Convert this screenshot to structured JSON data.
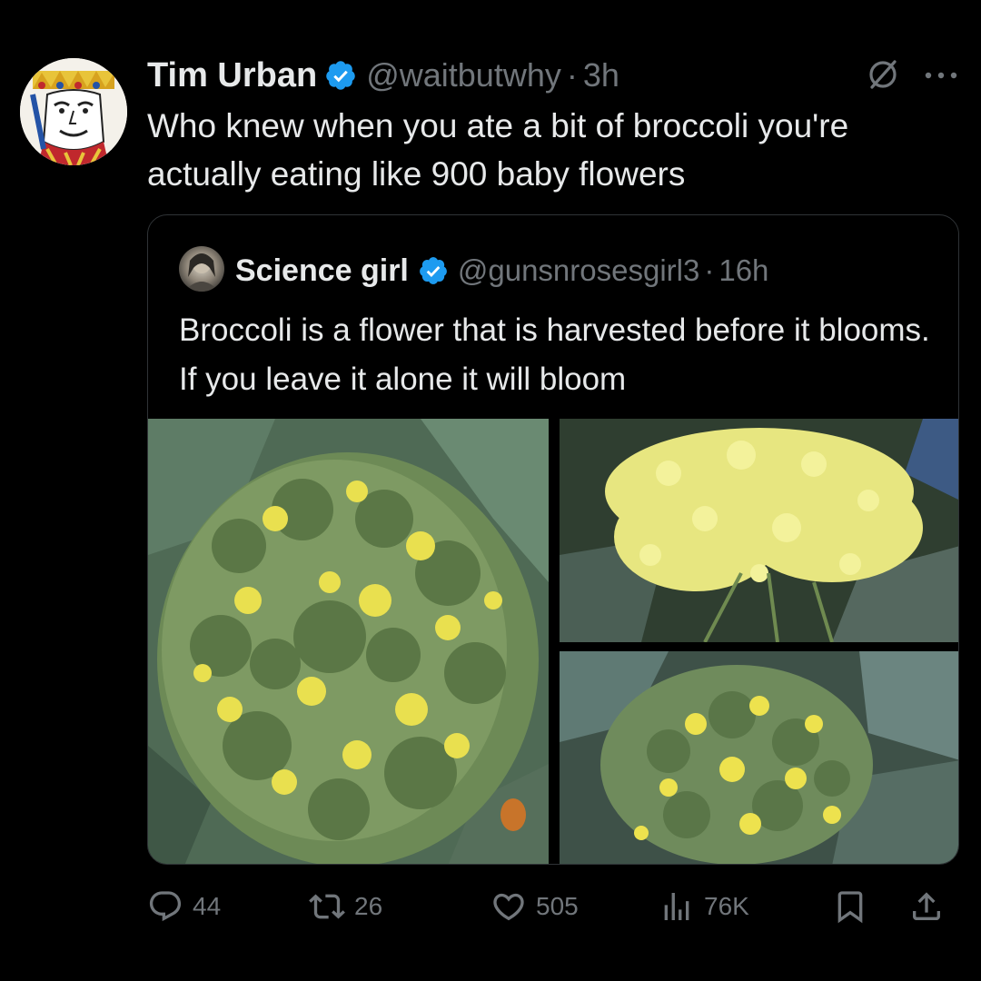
{
  "tweet": {
    "author_name": "Tim Urban",
    "handle": "@waitbutwhy",
    "separator": "·",
    "time": "3h",
    "text": "Who knew when you ate a bit of broccoli you're actually eating like 900 baby flowers"
  },
  "quoted_tweet": {
    "author_name": "Science girl",
    "handle": "@gunsnrosesgirl3",
    "separator": "·",
    "time": "16h",
    "text": "Broccoli is a flower that is harvested before it blooms. If you leave it alone it will bloom"
  },
  "actions": {
    "replies": "44",
    "reposts": "26",
    "likes": "505",
    "views": "76K"
  },
  "icons": {
    "verified": "verified-badge-icon",
    "grok": "grok-icon",
    "more": "more-icon",
    "reply": "reply-icon",
    "repost": "repost-icon",
    "like": "heart-icon",
    "views": "analytics-icon",
    "bookmark": "bookmark-icon",
    "share": "share-icon"
  },
  "colors": {
    "background": "#000000",
    "text": "#e7e9ea",
    "secondary_text": "#71767b",
    "verified": "#1d9bf0",
    "border": "#2f3336"
  }
}
